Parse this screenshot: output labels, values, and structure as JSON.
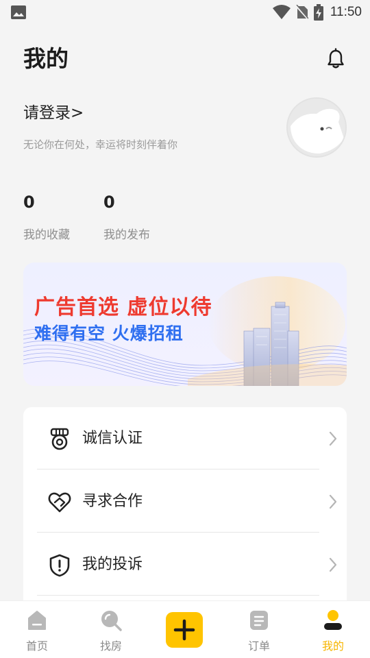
{
  "status_bar": {
    "time": "11:50"
  },
  "header": {
    "title": "我的"
  },
  "profile": {
    "login_text": "请登录>",
    "slogan": "无论你在何处，幸运将时刻伴着你"
  },
  "stats": [
    {
      "value": "0",
      "label": "我的收藏"
    },
    {
      "value": "0",
      "label": "我的发布"
    }
  ],
  "banner": {
    "line1": "广告首选  虚位以待",
    "line2": "难得有空  火爆招租",
    "colors": {
      "line1": "#ee3a2f",
      "line2": "#2f6ff0"
    }
  },
  "menu": [
    {
      "icon": "medal-icon",
      "label": "诚信认证"
    },
    {
      "icon": "handshake-heart-icon",
      "label": "寻求合作"
    },
    {
      "icon": "shield-alert-icon",
      "label": "我的投诉"
    }
  ],
  "tabbar": {
    "items": [
      {
        "icon": "home-icon",
        "label": "首页"
      },
      {
        "icon": "search-icon",
        "label": "找房"
      },
      {
        "icon": "plus-icon",
        "label": ""
      },
      {
        "icon": "order-icon",
        "label": "订单"
      },
      {
        "icon": "user-icon",
        "label": "我的"
      }
    ],
    "active": "我的",
    "accent": "#ffc400",
    "active_label_color": "#f7b500"
  }
}
